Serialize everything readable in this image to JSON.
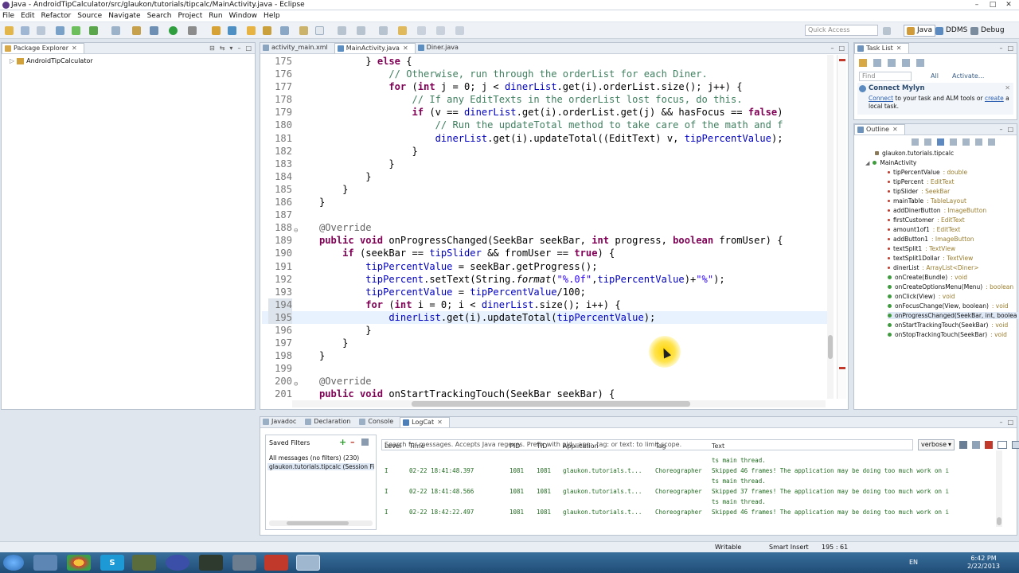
{
  "window": {
    "title": "Java - AndroidTipCalculator/src/glaukon/tutorials/tipcalc/MainActivity.java - Eclipse"
  },
  "menu": [
    "File",
    "Edit",
    "Refactor",
    "Source",
    "Navigate",
    "Search",
    "Project",
    "Run",
    "Window",
    "Help"
  ],
  "quick_access": {
    "placeholder": "Quick Access"
  },
  "perspectives": [
    "Java",
    "DDMS",
    "Debug"
  ],
  "package_explorer": {
    "tab": "Package Explorer",
    "project": "AndroidTipCalculator"
  },
  "editor": {
    "tabs": [
      "activity_main.xml",
      "MainActivity.java",
      "Diner.java"
    ],
    "active_tab": "MainActivity.java",
    "lines": [
      {
        "n": "175",
        "code": "        } else {"
      },
      {
        "n": "176",
        "code": "            // Otherwise, run through the orderList for each Diner."
      },
      {
        "n": "177",
        "code": "            for (int j = 0; j < dinerList.get(i).orderList.size(); j++) {"
      },
      {
        "n": "178",
        "code": "                // If any EditTexts in the orderList lost focus, do this."
      },
      {
        "n": "179",
        "code": "                if (v == dinerList.get(i).orderList.get(j) && hasFocus == false)"
      },
      {
        "n": "180",
        "code": "                    // Run the updateTotal method to take care of the math and f"
      },
      {
        "n": "181",
        "code": "                    dinerList.get(i).updateTotal((EditText) v, tipPercentValue);"
      },
      {
        "n": "182",
        "code": "                }"
      },
      {
        "n": "183",
        "code": "            }"
      },
      {
        "n": "184",
        "code": "        }"
      },
      {
        "n": "185",
        "code": "    }"
      },
      {
        "n": "186",
        "code": "}"
      },
      {
        "n": "187",
        "code": ""
      },
      {
        "n": "188",
        "code": "@Override"
      },
      {
        "n": "189",
        "code": "public void onProgressChanged(SeekBar seekBar, int progress, boolean fromUser) {"
      },
      {
        "n": "190",
        "code": "    if (seekBar == tipSlider && fromUser == true) {"
      },
      {
        "n": "191",
        "code": "        tipPercentValue = seekBar.getProgress();"
      },
      {
        "n": "192",
        "code": "        tipPercent.setText(String.format(\"%.0f\",tipPercentValue)+\"%\");"
      },
      {
        "n": "193",
        "code": "        tipPercentValue = tipPercentValue/100;"
      },
      {
        "n": "194",
        "code": "        for (int i = 0; i < dinerList.size(); i++) {"
      },
      {
        "n": "195",
        "code": "            dinerList.get(i).updateTotal(tipPercentValue);"
      },
      {
        "n": "196",
        "code": "        }"
      },
      {
        "n": "197",
        "code": "    }"
      },
      {
        "n": "198",
        "code": "}"
      },
      {
        "n": "199",
        "code": ""
      },
      {
        "n": "200",
        "code": "@Override"
      },
      {
        "n": "201",
        "code": "public void onStartTrackingTouch(SeekBar seekBar) {"
      }
    ]
  },
  "task_list": {
    "tab": "Task List",
    "find_placeholder": "Find",
    "all": "All",
    "activate": "Activate...",
    "mylyn_title": "Connect Mylyn",
    "mylyn_connect": "Connect",
    "mylyn_mid": " to your task and ALM tools or ",
    "mylyn_create": "create",
    "mylyn_end": " a local task."
  },
  "outline": {
    "tab": "Outline",
    "package": "glaukon.tutorials.tipcalc",
    "class": "MainActivity",
    "members": [
      {
        "name": "tipPercentValue",
        "type": ": double",
        "kind": "field"
      },
      {
        "name": "tipPercent",
        "type": ": EditText",
        "kind": "field"
      },
      {
        "name": "tipSlider",
        "type": ": SeekBar",
        "kind": "field"
      },
      {
        "name": "mainTable",
        "type": ": TableLayout",
        "kind": "field"
      },
      {
        "name": "addDinerButton",
        "type": ": ImageButton",
        "kind": "field"
      },
      {
        "name": "firstCustomer",
        "type": ": EditText",
        "kind": "field"
      },
      {
        "name": "amount1of1",
        "type": ": EditText",
        "kind": "field"
      },
      {
        "name": "addButton1",
        "type": ": ImageButton",
        "kind": "field"
      },
      {
        "name": "textSplit1",
        "type": ": TextView",
        "kind": "field"
      },
      {
        "name": "textSplit1Dollar",
        "type": ": TextView",
        "kind": "field"
      },
      {
        "name": "dinerList",
        "type": ": ArrayList<Diner>",
        "kind": "field"
      },
      {
        "name": "onCreate(Bundle)",
        "type": ": void",
        "kind": "method"
      },
      {
        "name": "onCreateOptionsMenu(Menu)",
        "type": ": boolean",
        "kind": "method"
      },
      {
        "name": "onClick(View)",
        "type": ": void",
        "kind": "method"
      },
      {
        "name": "onFocusChange(View, boolean)",
        "type": ": void",
        "kind": "method"
      },
      {
        "name": "onProgressChanged(SeekBar, int, boolea",
        "type": "",
        "kind": "method"
      },
      {
        "name": "onStartTrackingTouch(SeekBar)",
        "type": ": void",
        "kind": "method"
      },
      {
        "name": "onStopTrackingTouch(SeekBar)",
        "type": ": void",
        "kind": "method"
      }
    ]
  },
  "bottom_tabs": [
    "Javadoc",
    "Declaration",
    "Console",
    "LogCat"
  ],
  "logcat": {
    "saved_filters": "Saved Filters",
    "filters": [
      "All messages (no filters) (230)",
      "glaukon.tutorials.tipcalc (Session Filt"
    ],
    "search_placeholder": "Search for messages. Accepts Java regexes. Prefix with pid:, app:, tag: or text: to limit scope.",
    "verbosity": "verbose",
    "columns": [
      "Level",
      "Time",
      "PID",
      "TID",
      "Application",
      "Tag",
      "Text"
    ],
    "rows": [
      {
        "level": "",
        "time": "",
        "pid": "",
        "tid": "",
        "app": "",
        "tag": "",
        "text": "ts main thread."
      },
      {
        "level": "I",
        "time": "02-22 18:41:48.397",
        "pid": "1081",
        "tid": "1081",
        "app": "glaukon.tutorials.t...",
        "tag": "Choreographer",
        "text": "Skipped 46 frames!  The application may be doing too much work on i"
      },
      {
        "level": "",
        "time": "",
        "pid": "",
        "tid": "",
        "app": "",
        "tag": "",
        "text": "ts main thread."
      },
      {
        "level": "I",
        "time": "02-22 18:41:48.566",
        "pid": "1081",
        "tid": "1081",
        "app": "glaukon.tutorials.t...",
        "tag": "Choreographer",
        "text": "Skipped 37 frames!  The application may be doing too much work on i"
      },
      {
        "level": "",
        "time": "",
        "pid": "",
        "tid": "",
        "app": "",
        "tag": "",
        "text": "ts main thread."
      },
      {
        "level": "I",
        "time": "02-22 18:42:22.497",
        "pid": "1081",
        "tid": "1081",
        "app": "glaukon.tutorials.t...",
        "tag": "Choreographer",
        "text": "Skipped 46 frames!  The application may be doing too much work on i"
      }
    ]
  },
  "status_bar": {
    "writable": "Writable",
    "insert_mode": "Smart Insert",
    "position": "195 : 61"
  },
  "taskbar": {
    "lang": "EN",
    "time": "6:42 PM",
    "date": "2/22/2013"
  }
}
